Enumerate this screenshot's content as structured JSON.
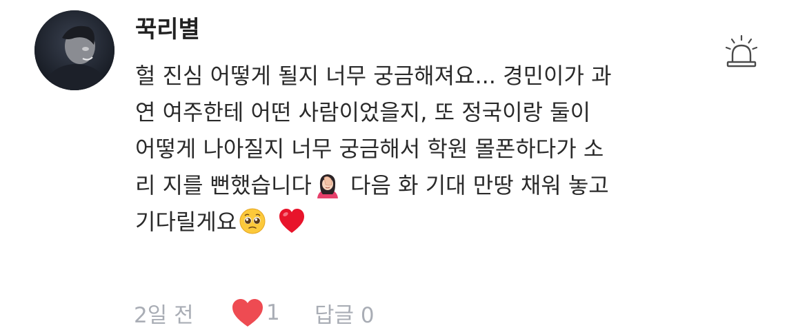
{
  "comment": {
    "author": "꾹리별",
    "avatar_icon": "profile-photo",
    "lines": [
      "헐 진심 어떻게 될지 너무 궁금해져요... 경민이가 과",
      "연 여주한테 어떤 사람이었을지, 또 정국이랑 둘이",
      "어떻게 나아질지 너무 궁금해서 학원 몰폰하다가 소",
      "리 지를 뻔했습니다",
      "다음 화 기대 만땅 채워 놓고",
      "기다릴게요"
    ],
    "emojis": {
      "facepalm": "face-palm-emoji",
      "pleading": "pleading-face-emoji",
      "heart": "red-heart-emoji"
    },
    "time": "2일 전",
    "like_count": "1",
    "reply_label": "답글 0"
  },
  "icons": {
    "report": "siren-icon",
    "like": "heart-icon"
  },
  "colors": {
    "text": "#2a2a2a",
    "meta": "#a9adb5",
    "like_heart": "#ee4b52",
    "heart_emoji": "#e8142b"
  }
}
